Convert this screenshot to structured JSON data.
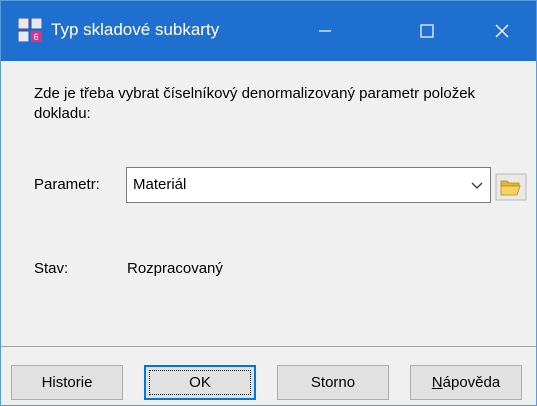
{
  "window": {
    "title": "Typ skladové subkarty",
    "app_icon": "app-logo-icon",
    "controls": [
      "minimize-icon",
      "maximize-icon",
      "close-icon"
    ]
  },
  "content": {
    "message": "Zde je třeba vybrat číselníkový denormalizovaný parametr položek dokladu:",
    "parametr_label": "Parametr:",
    "parametr_value": "Materiál",
    "stav_label": "Stav:",
    "stav_value": "Rozpracovaný"
  },
  "buttons": {
    "historie": "Historie",
    "ok": "OK",
    "storno": "Storno",
    "napoveda_mnemonic": "N",
    "napoveda_rest": "ápověda"
  },
  "colors": {
    "titlebar": "#1e6fd0",
    "accent": "#0078d7",
    "folder": "#f0c040"
  }
}
